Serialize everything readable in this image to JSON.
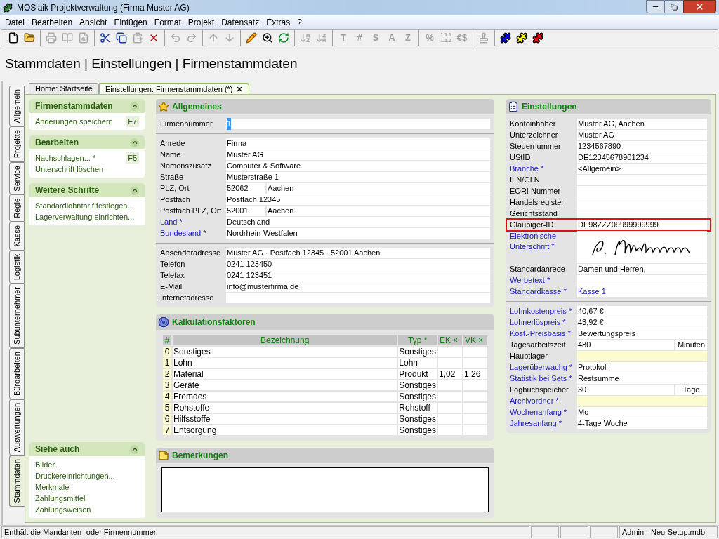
{
  "window": {
    "title": "MOS'aik Projektverwaltung (Firma Muster AG)"
  },
  "menu": [
    "Datei",
    "Bearbeiten",
    "Ansicht",
    "Einfügen",
    "Format",
    "Projekt",
    "Datensatz",
    "Extras",
    "?"
  ],
  "toolbar": [
    [
      {
        "disabled": false
      },
      {
        "disabled": false
      }
    ],
    [
      {
        "disabled": true
      },
      {
        "disabled": true
      },
      {
        "disabled": true
      }
    ],
    [
      {
        "disabled": false
      },
      {
        "disabled": false
      },
      {
        "disabled": true
      },
      {
        "disabled": false
      }
    ],
    [
      {
        "disabled": true
      },
      {
        "disabled": true
      }
    ],
    [
      {
        "disabled": true
      },
      {
        "disabled": true
      }
    ],
    [
      {
        "disabled": false
      },
      {
        "disabled": false
      },
      {
        "disabled": false
      }
    ],
    [
      {
        "disabled": true
      },
      {
        "disabled": true
      }
    ],
    [
      {
        "glyph": "T",
        "disabled": true
      },
      {
        "glyph": "#",
        "disabled": true
      },
      {
        "glyph": "S",
        "disabled": true
      },
      {
        "glyph": "A",
        "disabled": true
      },
      {
        "glyph": "Z",
        "disabled": true
      }
    ],
    [
      {
        "glyph": "%",
        "disabled": true
      },
      {
        "glyph": "1.1.1 1.1.2",
        "disabled": true
      },
      {
        "glyph": "€$",
        "disabled": true
      }
    ],
    [
      {
        "disabled": true
      }
    ],
    [
      {
        "disabled": false
      },
      {
        "disabled": false
      },
      {
        "disabled": false
      }
    ]
  ],
  "breadcrumb": "Stammdaten | Einstellungen | Firmenstammdaten",
  "side_tabs": [
    {
      "label": "Allgemein",
      "selected": false
    },
    {
      "label": "Projekte",
      "selected": false
    },
    {
      "label": "Service",
      "selected": false
    },
    {
      "label": "Regie",
      "selected": false
    },
    {
      "label": "Kasse",
      "selected": false
    },
    {
      "label": "Logistik",
      "selected": false
    },
    {
      "label": "Subunternehmer",
      "selected": false
    },
    {
      "label": "Büroarbeiten",
      "selected": false
    },
    {
      "label": "Auswertungen",
      "selected": false
    },
    {
      "label": "Stammdaten",
      "selected": true
    }
  ],
  "doc_tabs": [
    {
      "label": "Home: Startseite",
      "selected": false,
      "closable": false
    },
    {
      "label": "Einstellungen: Firmenstammdaten (*)",
      "selected": true,
      "closable": true
    }
  ],
  "task_panes": [
    {
      "title": "Firmenstammdaten",
      "items": [
        {
          "label": "Änderungen speichern",
          "shortcut": "F7"
        }
      ]
    },
    {
      "title": "Bearbeiten",
      "items": [
        {
          "label": "Nachschlagen... *",
          "shortcut": "F5"
        },
        {
          "label": "Unterschrift löschen"
        }
      ]
    },
    {
      "title": "Weitere Schritte",
      "items": [
        {
          "label": "Standardlohntarif festlegen..."
        },
        {
          "label": "Lagerverwaltung einrichten..."
        }
      ]
    },
    {
      "title": "Siehe auch",
      "items": [
        {
          "label": "Bilder..."
        },
        {
          "label": "Druckereinrichtungen..."
        },
        {
          "label": "Merkmale"
        },
        {
          "label": "Zahlungsmittel"
        },
        {
          "label": "Zahlungsweisen"
        }
      ]
    }
  ],
  "allgemeines": {
    "title": "Allgemeines",
    "groups": [
      [
        {
          "label": "Firmennummer",
          "link": false,
          "fields": [
            {
              "value": "1",
              "selected": true
            }
          ]
        }
      ],
      [
        {
          "label": "Anrede",
          "link": false,
          "fields": [
            {
              "value": "Firma"
            }
          ]
        },
        {
          "label": "Name",
          "link": false,
          "fields": [
            {
              "value": "Muster AG"
            }
          ]
        },
        {
          "label": "Namenszusatz",
          "link": false,
          "fields": [
            {
              "value": "Computer & Software"
            }
          ]
        },
        {
          "label": "Straße",
          "link": false,
          "fields": [
            {
              "value": "Musterstraße 1"
            }
          ]
        },
        {
          "label": "PLZ, Ort",
          "link": false,
          "fields": [
            {
              "value": "52062"
            },
            {
              "value": "Aachen"
            }
          ]
        },
        {
          "label": "Postfach",
          "link": false,
          "fields": [
            {
              "value": "Postfach 12345"
            }
          ]
        },
        {
          "label": "Postfach PLZ, Ort",
          "link": false,
          "fields": [
            {
              "value": "52001"
            },
            {
              "value": "Aachen"
            }
          ]
        },
        {
          "label": "Land *",
          "link": true,
          "fields": [
            {
              "value": "Deutschland"
            }
          ]
        },
        {
          "label": "Bundesland *",
          "link": true,
          "fields": [
            {
              "value": "Nordrhein-Westfalen"
            }
          ]
        }
      ],
      [
        {
          "label": "Absenderadresse",
          "link": false,
          "fields": [
            {
              "value": "Muster AG · Postfach 12345 · 52001 Aachen"
            }
          ]
        },
        {
          "label": "Telefon",
          "link": false,
          "fields": [
            {
              "value": "0241 123450"
            }
          ]
        },
        {
          "label": "Telefax",
          "link": false,
          "fields": [
            {
              "value": "0241 123451"
            }
          ]
        },
        {
          "label": "E-Mail",
          "link": false,
          "fields": [
            {
              "value": "info@musterfirma.de"
            }
          ]
        },
        {
          "label": "Internetadresse",
          "link": false
        }
      ]
    ]
  },
  "kalkulationsfaktoren": {
    "title": "Kalkulationsfaktoren",
    "columns": [
      "#",
      "Bezeichnung",
      "Typ *",
      "EK ×",
      "VK ×"
    ],
    "rows": [
      [
        "0",
        "Sonstiges",
        "Sonstiges",
        "",
        ""
      ],
      [
        "1",
        "Lohn",
        "Lohn",
        "",
        ""
      ],
      [
        "2",
        "Material",
        "Produkt",
        "1,02",
        "1,26"
      ],
      [
        "3",
        "Geräte",
        "Sonstiges",
        "",
        ""
      ],
      [
        "4",
        "Fremdes",
        "Sonstiges",
        "",
        ""
      ],
      [
        "5",
        "Rohstoffe",
        "Rohstoff",
        "",
        ""
      ],
      [
        "6",
        "Hilfsstoffe",
        "Sonstiges",
        "",
        ""
      ],
      [
        "7",
        "Entsorgung",
        "Sonstiges",
        "",
        ""
      ]
    ]
  },
  "bemerkungen": {
    "title": "Bemerkungen"
  },
  "einstellungen": {
    "title": "Einstellungen",
    "groups": [
      [
        {
          "label": "Kontoinhaber",
          "link": false,
          "fields": [
            {
              "value": "Muster AG, Aachen"
            }
          ]
        },
        {
          "label": "Unterzeichner",
          "link": false,
          "fields": [
            {
              "value": "Muster AG"
            }
          ]
        },
        {
          "label": "Steuernummer",
          "link": false,
          "fields": [
            {
              "value": "1234567890"
            }
          ]
        },
        {
          "label": "UStID",
          "link": false,
          "fields": [
            {
              "value": "DE12345678901234"
            }
          ]
        },
        {
          "label": "Branche *",
          "link": true,
          "fields": [
            {
              "value": "<Allgemein>"
            }
          ]
        },
        {
          "label": "ILN/GLN",
          "link": false
        },
        {
          "label": "EORI Nummer",
          "link": false
        },
        {
          "label": "Handelsregister",
          "link": false
        },
        {
          "label": "Gerichtsstand",
          "link": false
        },
        {
          "label": "Gläubiger-ID",
          "link": false,
          "marked": true,
          "fields": [
            {
              "value": "DE98ZZZ09999999999"
            }
          ]
        },
        {
          "label": "Elektronische Unterschrift *",
          "link": true,
          "kind": "signature"
        },
        {
          "label": "Standardanrede",
          "link": false,
          "fields": [
            {
              "value": "Damen und Herren,"
            }
          ]
        },
        {
          "label": "Werbetext *",
          "link": true
        },
        {
          "label": "Standardkasse *",
          "link": true,
          "fields": [
            {
              "value": "Kasse 1",
              "link": true
            }
          ]
        }
      ],
      [
        {
          "label": "Lohnkostenpreis *",
          "link": true,
          "fields": [
            {
              "value": "40,67 €"
            }
          ]
        },
        {
          "label": "Lohnerlöspreis *",
          "link": true,
          "fields": [
            {
              "value": "43,92 €"
            }
          ]
        },
        {
          "label": "Kost.-Preisbasis *",
          "link": true,
          "fields": [
            {
              "value": "Bewertungspreis"
            }
          ]
        },
        {
          "label": "Tagesarbeitszeit",
          "link": false,
          "fields": [
            {
              "value": "480"
            },
            {
              "value": "Minuten",
              "unit": true
            }
          ]
        },
        {
          "label": "Hauptlager",
          "link": false,
          "fields": [
            {
              "highlighted": true
            }
          ]
        },
        {
          "label": "Lagerüberwachg *",
          "link": true,
          "fields": [
            {
              "value": "Protokoll"
            }
          ]
        },
        {
          "label": "Statistik bei Sets *",
          "link": true,
          "fields": [
            {
              "value": "Restsumme"
            }
          ]
        },
        {
          "label": "Logbuchspeicher",
          "link": false,
          "fields": [
            {
              "value": "30"
            },
            {
              "value": "Tage",
              "unit": true
            }
          ]
        },
        {
          "label": "Archivordner *",
          "link": true,
          "fields": [
            {
              "highlighted": true
            }
          ]
        },
        {
          "label": "Wochenanfang *",
          "link": true,
          "fields": [
            {
              "value": "Mo"
            }
          ]
        },
        {
          "label": "Jahresanfang *",
          "link": true,
          "fields": [
            {
              "value": "4-Tage Woche"
            }
          ]
        }
      ]
    ]
  },
  "status_bar": {
    "message": "Enthält die Mandanten- oder Firmennummer.",
    "database": "Admin - Neu-Setup.mdb"
  }
}
